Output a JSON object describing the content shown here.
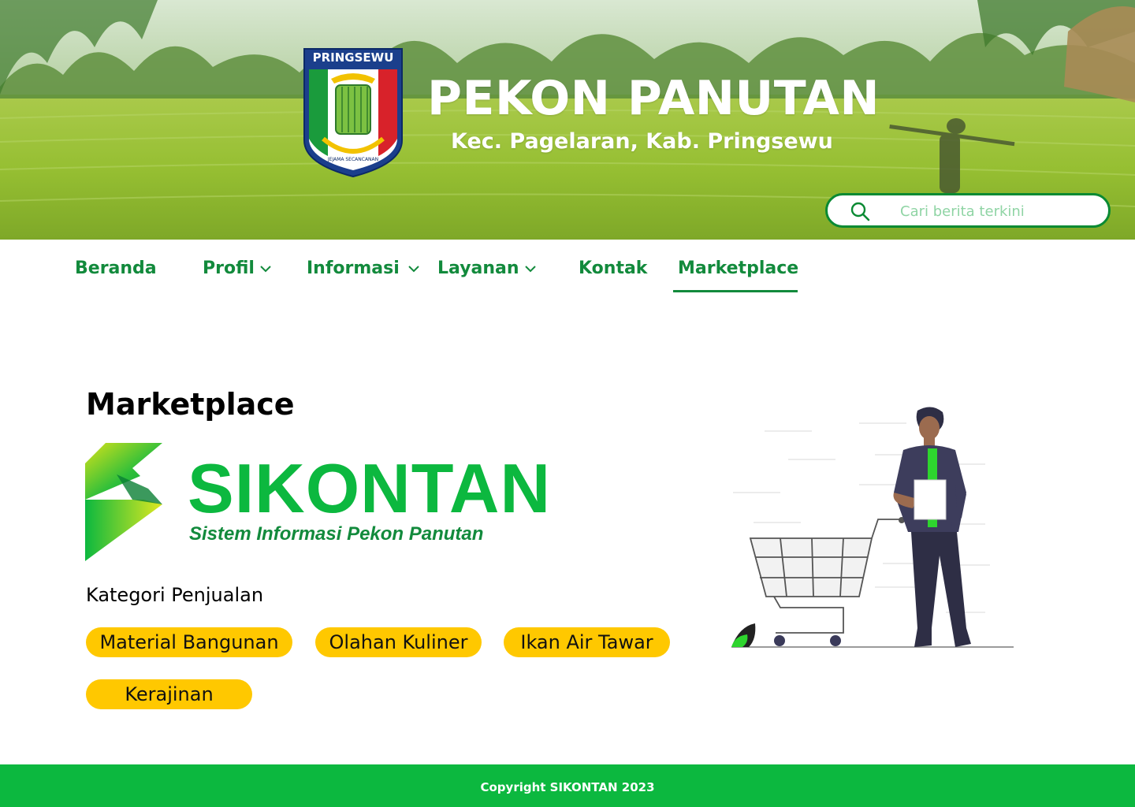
{
  "header": {
    "emblem_text": "PRINGSEWU",
    "emblem_motto": "JEJAMA SECANCANAN",
    "title": "PEKON PANUTAN",
    "subtitle": "Kec. Pagelaran, Kab. Pringsewu",
    "search_placeholder": "Cari berita terkini",
    "search_icon": "search-icon"
  },
  "nav": {
    "items": [
      {
        "label": "Beranda",
        "dropdown": false
      },
      {
        "label": "Profil",
        "dropdown": true
      },
      {
        "label": "Informasi",
        "dropdown": true
      },
      {
        "label": "Layanan",
        "dropdown": true
      },
      {
        "label": "Kontak",
        "dropdown": false
      },
      {
        "label": "Marketplace",
        "dropdown": false,
        "active": true
      }
    ]
  },
  "main": {
    "title": "Marketplace",
    "logo": {
      "wordmark": "SIKONTAN",
      "tagline": "Sistem Informasi Pekon Panutan"
    },
    "category_label": "Kategori Penjualan",
    "categories": [
      "Material Bangunan",
      "Olahan Kuliner",
      "Ikan Air Tawar",
      "Kerajinan"
    ]
  },
  "footer": {
    "copyright": "Copyright SIKONTAN 2023"
  },
  "colors": {
    "primary_green": "#0cb83f",
    "nav_green": "#128a3c",
    "chip_yellow": "#ffc800"
  }
}
